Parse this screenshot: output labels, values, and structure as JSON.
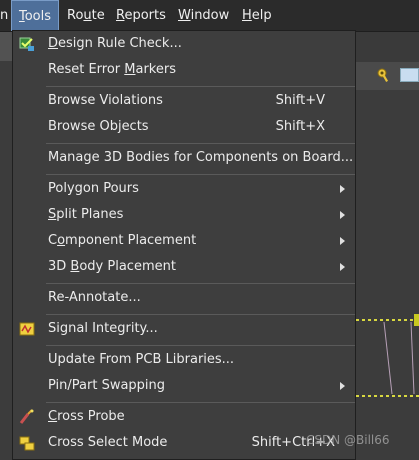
{
  "menubar": {
    "items": [
      {
        "label": "n"
      },
      {
        "label": "Tools",
        "underline": "T",
        "rest": "ools"
      },
      {
        "label": "Route",
        "pre": "Ro",
        "underline": "u",
        "rest": "te"
      },
      {
        "label": "Reports",
        "underline": "R",
        "rest": "eports"
      },
      {
        "label": "Window",
        "underline": "W",
        "rest": "indow"
      },
      {
        "label": "Help",
        "underline": "H",
        "rest": "elp"
      }
    ]
  },
  "menu": {
    "items": [
      {
        "pre": "",
        "underline": "D",
        "rest": "esign Rule Check...",
        "shortcut": "",
        "icon": "design-rule-check-icon"
      },
      {
        "pre": "Reset Error ",
        "underline": "M",
        "rest": "arkers",
        "shortcut": ""
      },
      {
        "pre": "Browse Violations",
        "underline": "",
        "rest": "",
        "shortcut": "Shift+V"
      },
      {
        "pre": "Browse Objects",
        "underline": "",
        "rest": "",
        "shortcut": "Shift+X"
      },
      {
        "pre": "Manage 3D Bodies for Components on Board...",
        "underline": "",
        "rest": "",
        "shortcut": ""
      },
      {
        "pre": "Polygon Pours",
        "underline": "",
        "rest": "",
        "shortcut": "",
        "submenu": true
      },
      {
        "pre": "",
        "underline": "S",
        "rest": "plit Planes",
        "shortcut": "",
        "submenu": true
      },
      {
        "pre": "C",
        "underline": "o",
        "rest": "mponent Placement",
        "shortcut": "",
        "submenu": true
      },
      {
        "pre": "3D ",
        "underline": "B",
        "rest": "ody Placement",
        "shortcut": "",
        "submenu": true
      },
      {
        "pre": "Re-Annotate...",
        "underline": "",
        "rest": "",
        "shortcut": ""
      },
      {
        "pre": "Signal Integrity...",
        "underline": "",
        "rest": "",
        "shortcut": "",
        "icon": "signal-integrity-icon"
      },
      {
        "pre": "Update From PCB Libraries...",
        "underline": "",
        "rest": "",
        "shortcut": ""
      },
      {
        "pre": "Pin/Part Swapping",
        "underline": "",
        "rest": "",
        "shortcut": "",
        "submenu": true
      },
      {
        "pre": "",
        "underline": "C",
        "rest": "ross Probe",
        "shortcut": "",
        "icon": "cross-probe-icon"
      },
      {
        "pre": "Cross Select Mode",
        "underline": "",
        "rest": "",
        "shortcut": "Shift+Ctrl+X",
        "icon": "cross-select-icon"
      }
    ]
  },
  "watermark": "CSDN @Bill66"
}
